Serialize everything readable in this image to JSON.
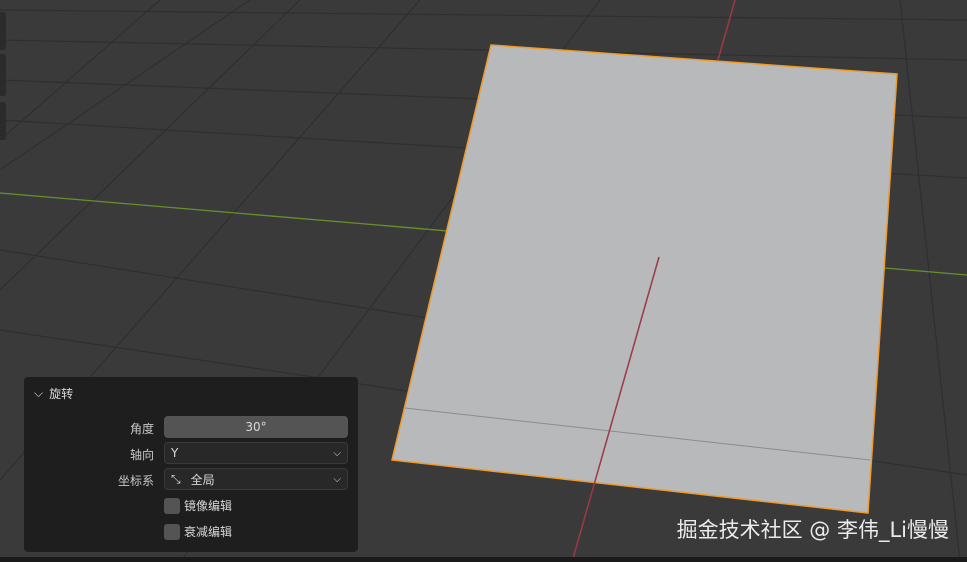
{
  "panel": {
    "title": "旋转",
    "angle_label": "角度",
    "angle_value": "30°",
    "axis_label": "轴向",
    "axis_value": "Y",
    "orient_label": "坐标系",
    "orient_value": "全局",
    "mirror_label": "镜像编辑",
    "proportional_label": "衰减编辑"
  },
  "watermark": "掘金技术社区 @ 李伟_Li慢慢",
  "colors": {
    "x_axis": "#9a3a48",
    "y_axis": "#6a8f2a",
    "selection": "#f09a2a",
    "plane": "#b7b9bb"
  }
}
